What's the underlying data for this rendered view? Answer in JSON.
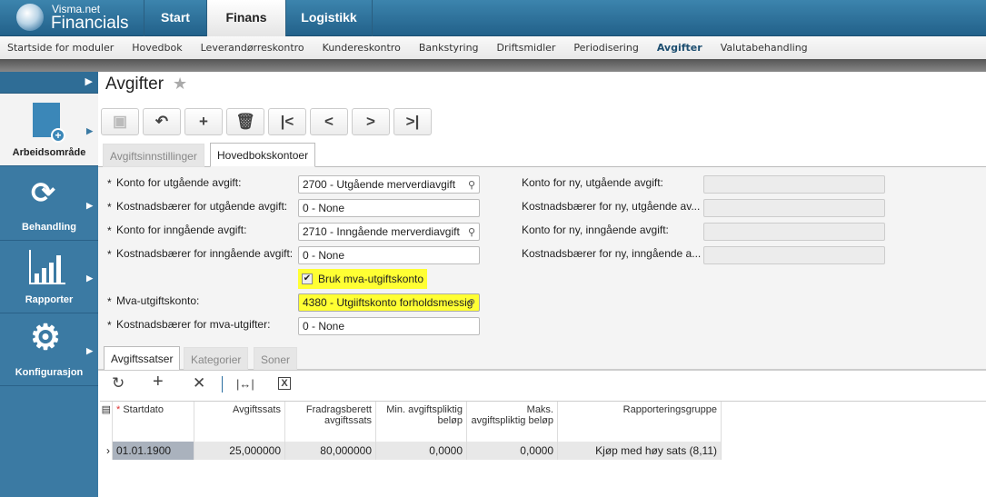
{
  "app": {
    "brand_small": "Visma.net",
    "brand_large": "Financials"
  },
  "main_tabs": [
    "Start",
    "Finans",
    "Logistikk"
  ],
  "subnav": [
    "Startside for moduler",
    "Hovedbok",
    "Leverandørreskontro",
    "Kundereskontro",
    "Bankstyring",
    "Driftsmidler",
    "Periodisering",
    "Avgifter",
    "Valutabehandling"
  ],
  "sidebar": [
    "Arbeidsområde",
    "Behandling",
    "Rapporter",
    "Konfigurasjon"
  ],
  "page": {
    "title": "Avgifter"
  },
  "form_tabs": [
    "Avgiftsinnstillinger",
    "Hovedbokskontoer"
  ],
  "fields_left": [
    {
      "label": "Konto for utgående avgift:",
      "value": "2700 - Utgående merverdiavgift"
    },
    {
      "label": "Kostnadsbærer for utgående avgift:",
      "value": "0 - None"
    },
    {
      "label": "Konto for inngående avgift:",
      "value": "2710 - Inngående merverdiavgift"
    },
    {
      "label": "Kostnadsbærer for inngående avgift:",
      "value": "0 - None"
    },
    {
      "label": "Mva-utgiftskonto:",
      "value": "4380 - Utgiiftskonto forholdsmessig"
    },
    {
      "label": "Kostnadsbærer for mva-utgifter:",
      "value": "0 - None"
    }
  ],
  "checkbox": {
    "label": "Bruk mva-utgiftskonto",
    "checked": true
  },
  "fields_right": [
    "Konto for ny, utgående avgift:",
    "Kostnadsbærer for ny, utgående av...",
    "Konto for ny, inngående avgift:",
    "Kostnadsbærer for ny, inngående a..."
  ],
  "lower_tabs": [
    "Avgiftssatser",
    "Kategorier",
    "Soner"
  ],
  "grid": {
    "headers": [
      "Startdato",
      "Avgiftssats",
      "Fradragsberett avgiftssats",
      "Min. avgiftspliktig beløp",
      "Maks. avgiftspliktig beløp",
      "Rapporteringsgruppe"
    ],
    "rows": [
      [
        "01.01.1900",
        "25,000000",
        "80,000000",
        "0,0000",
        "0,0000",
        "Kjøp med høy sats (8,11)"
      ]
    ]
  }
}
